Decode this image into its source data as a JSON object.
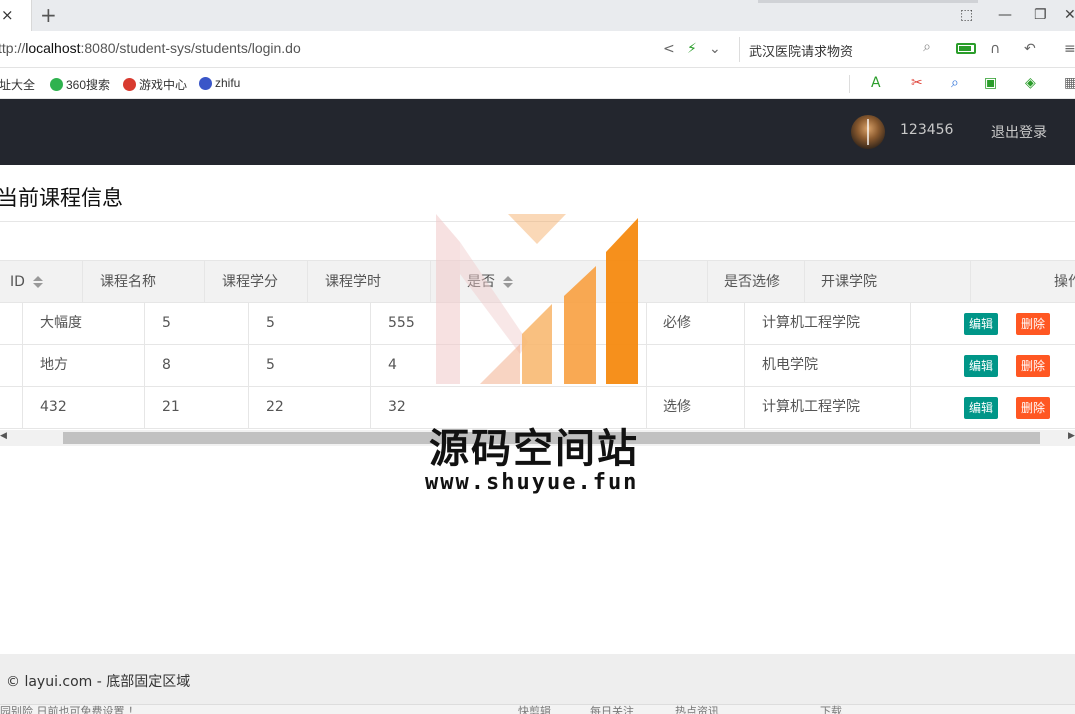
{
  "browser": {
    "tab_close_glyph": "×",
    "new_tab_glyph": "+",
    "window_controls": [
      "⬚",
      "—",
      "❐",
      "✕"
    ],
    "url_prefix": "ttp://",
    "url_host": "localhost",
    "url_rest": ":8080/student-sys/students/login.do",
    "search_text": "武汉医院请求物资",
    "bookmarks": [
      "址大全",
      "360搜索",
      "游戏中心",
      "zhifu"
    ]
  },
  "header": {
    "username": "123456",
    "logout_label": "退出登录"
  },
  "page": {
    "title": "当前课程信息"
  },
  "table": {
    "headers": [
      "ID",
      "课程名称",
      "课程学分",
      "课程学时",
      "是否",
      "是否选修",
      "开课学院",
      "操作"
    ],
    "rows": [
      {
        "name": "大幅度",
        "credit": "5",
        "credit2": "5",
        "hours": "555",
        "required": "必修",
        "college": "计算机工程学院"
      },
      {
        "name": "地方",
        "credit": "8",
        "credit2": "5",
        "hours": "4",
        "required": "",
        "college": "机电学院"
      },
      {
        "name": "432",
        "credit": "21",
        "credit2": "22",
        "hours": "32",
        "required": "选修",
        "college": "计算机工程学院"
      }
    ],
    "edit_label": "编辑",
    "delete_label": "删除"
  },
  "watermark": {
    "title": "源码空间站",
    "url": "www.shuyue.fun"
  },
  "footer": {
    "text": "© layui.com - 底部固定区域"
  },
  "statusbar": {
    "left": "园别险  日前也可免费设置 ！",
    "items": [
      "快剪辑",
      "每日关注",
      "热点资讯",
      "下载"
    ]
  },
  "colors": {
    "header_bg": "#23262e",
    "edit_btn": "#009688",
    "delete_btn": "#ff5722"
  }
}
